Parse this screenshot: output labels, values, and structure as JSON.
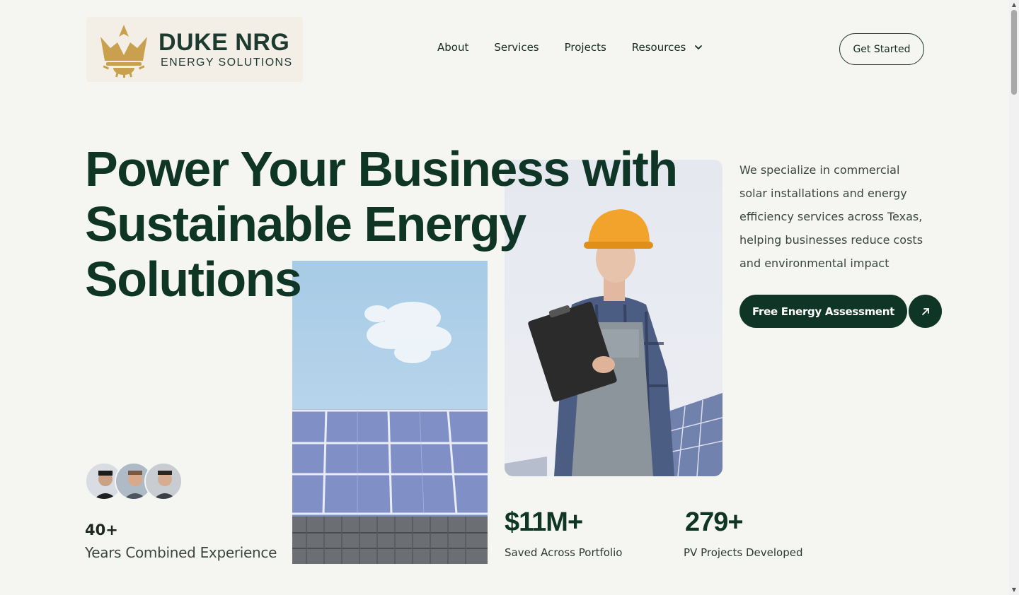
{
  "brand": {
    "name": "DUKE NRG",
    "tagline": "ENERGY SOLUTIONS",
    "accent_color": "#c9a14e"
  },
  "nav": {
    "items": [
      {
        "label": "About"
      },
      {
        "label": "Services"
      },
      {
        "label": "Projects"
      },
      {
        "label": "Resources",
        "has_dropdown": true
      }
    ],
    "cta_label": "Get Started"
  },
  "hero": {
    "title_lines": [
      "Power Your Business with",
      "Sustainable Energy",
      "Solutions"
    ],
    "description": "We specialize in commercial solar installations and energy efficiency services across Texas, helping businesses reduce costs and environmental impact",
    "cta_label": "Free Energy Assessment",
    "cta_icon": "arrow-up-right-icon",
    "images": [
      "solar-worker-photo",
      "rooftop-solar-panel-photo"
    ]
  },
  "stats": {
    "experience": {
      "value": "40+",
      "label": "Years Combined Experience"
    },
    "saved": {
      "value": "$11M+",
      "label": "Saved Across Portfolio"
    },
    "projects": {
      "value": "279+",
      "label": "PV Projects Developed"
    }
  },
  "colors": {
    "primary": "#0f3527",
    "background": "#f5f6f1"
  }
}
